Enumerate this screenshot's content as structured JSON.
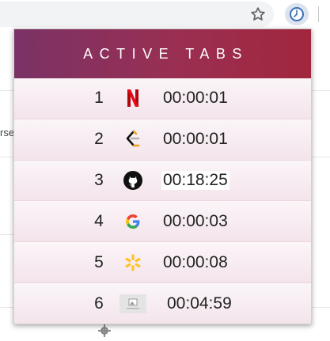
{
  "browser": {
    "star_icon": "star-outline",
    "extension_icon": "clock"
  },
  "background": {
    "partial_text": "rse"
  },
  "popup": {
    "title": "ACTIVE TABS",
    "rows": [
      {
        "index": "1",
        "favicon": "netflix-icon",
        "time": "00:00:01"
      },
      {
        "index": "2",
        "favicon": "leetcode-icon",
        "time": "00:00:01"
      },
      {
        "index": "3",
        "favicon": "github-icon",
        "time": "00:18:25"
      },
      {
        "index": "4",
        "favicon": "google-icon",
        "time": "00:00:03"
      },
      {
        "index": "5",
        "favicon": "walmart-icon",
        "time": "00:00:08"
      },
      {
        "index": "6",
        "favicon": "generic-page-icon",
        "time": "00:04:59"
      }
    ]
  },
  "colors": {
    "header_start": "#7a3266",
    "header_end": "#a1263d",
    "row_bg": "#f6ebf0"
  }
}
